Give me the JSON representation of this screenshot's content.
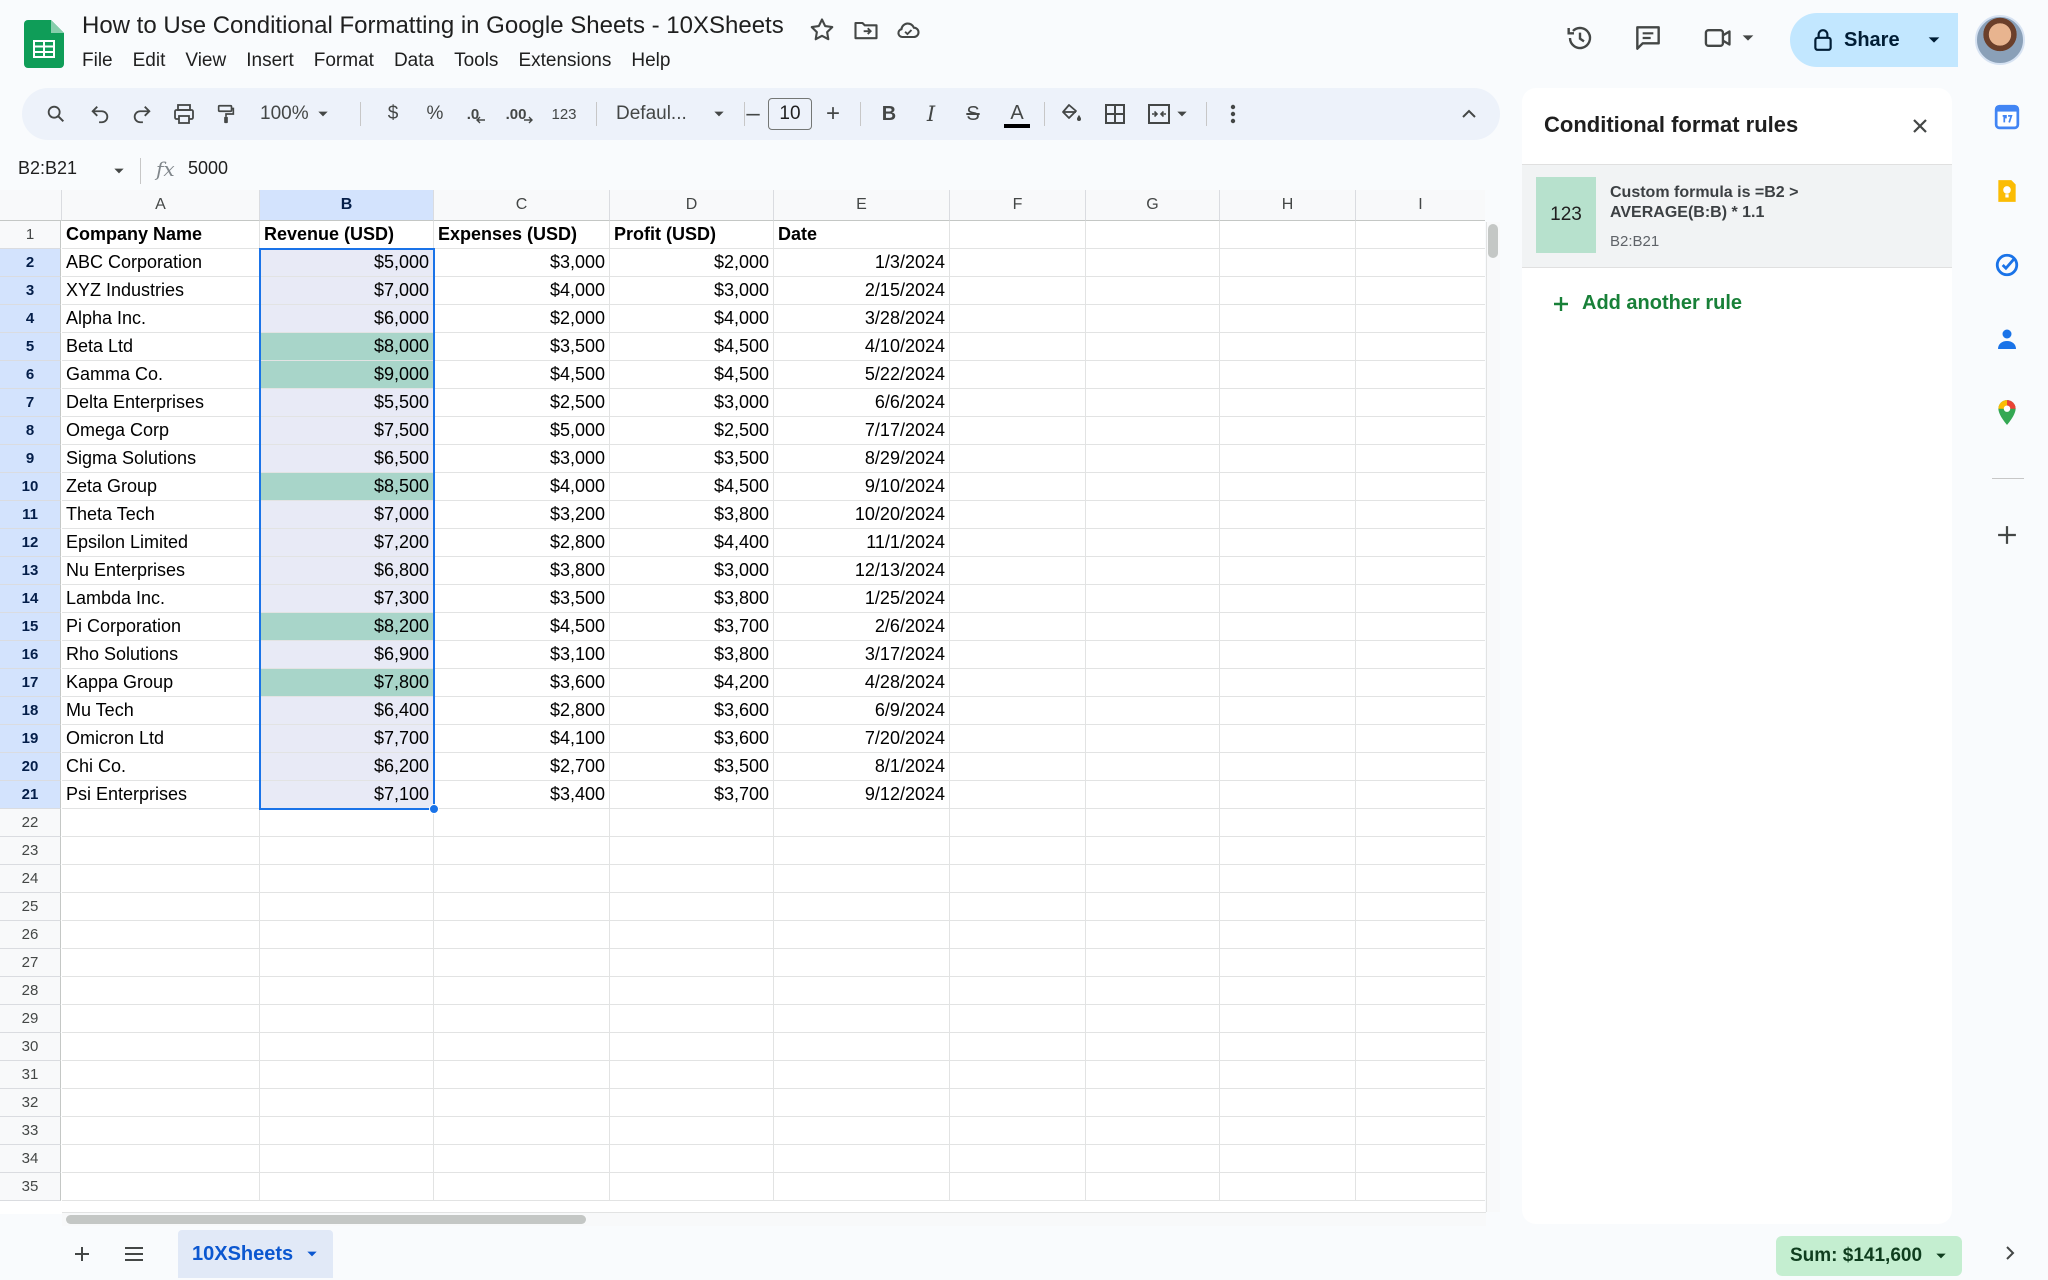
{
  "document": {
    "title": "How to Use Conditional Formatting in Google Sheets - 10XSheets"
  },
  "menu": [
    "File",
    "Edit",
    "View",
    "Insert",
    "Format",
    "Data",
    "Tools",
    "Extensions",
    "Help"
  ],
  "share": {
    "label": "Share"
  },
  "toolbar": {
    "zoom": "100%",
    "currency": "$",
    "percent": "%",
    "decrease_decimals": ".0",
    "increase_decimals": ".00",
    "number_format": "123",
    "font": "Defaul...",
    "font_size": "10",
    "minus": "–",
    "plus": "+",
    "bold": "B",
    "italic": "I",
    "strikethrough": "S",
    "text_color": "A"
  },
  "formula_bar": {
    "name_box": "B2:B21",
    "fx": "fx",
    "value": "5000"
  },
  "columns": [
    "A",
    "B",
    "C",
    "D",
    "E",
    "F",
    "G",
    "H",
    "I"
  ],
  "row_numbers": [
    "1",
    "2",
    "3",
    "4",
    "5",
    "6",
    "7",
    "8",
    "9",
    "10",
    "11",
    "12",
    "13",
    "14",
    "15",
    "16",
    "17",
    "18",
    "19",
    "20",
    "21",
    "22",
    "23",
    "24",
    "25",
    "26",
    "27",
    "28",
    "29",
    "30",
    "31",
    "32",
    "33",
    "34",
    "35"
  ],
  "table": {
    "headers": [
      "Company Name",
      "Revenue (USD)",
      "Expenses (USD)",
      "Profit (USD)",
      "Date"
    ],
    "rows": [
      [
        "ABC Corporation",
        "$5,000",
        "$3,000",
        "$2,000",
        "1/3/2024"
      ],
      [
        "XYZ Industries",
        "$7,000",
        "$4,000",
        "$3,000",
        "2/15/2024"
      ],
      [
        "Alpha Inc.",
        "$6,000",
        "$2,000",
        "$4,000",
        "3/28/2024"
      ],
      [
        "Beta Ltd",
        "$8,000",
        "$3,500",
        "$4,500",
        "4/10/2024"
      ],
      [
        "Gamma Co.",
        "$9,000",
        "$4,500",
        "$4,500",
        "5/22/2024"
      ],
      [
        "Delta Enterprises",
        "$5,500",
        "$2,500",
        "$3,000",
        "6/6/2024"
      ],
      [
        "Omega Corp",
        "$7,500",
        "$5,000",
        "$2,500",
        "7/17/2024"
      ],
      [
        "Sigma Solutions",
        "$6,500",
        "$3,000",
        "$3,500",
        "8/29/2024"
      ],
      [
        "Zeta Group",
        "$8,500",
        "$4,000",
        "$4,500",
        "9/10/2024"
      ],
      [
        "Theta Tech",
        "$7,000",
        "$3,200",
        "$3,800",
        "10/20/2024"
      ],
      [
        "Epsilon Limited",
        "$7,200",
        "$2,800",
        "$4,400",
        "11/1/2024"
      ],
      [
        "Nu Enterprises",
        "$6,800",
        "$3,800",
        "$3,000",
        "12/13/2024"
      ],
      [
        "Lambda Inc.",
        "$7,300",
        "$3,500",
        "$3,800",
        "1/25/2024"
      ],
      [
        "Pi Corporation",
        "$8,200",
        "$4,500",
        "$3,700",
        "2/6/2024"
      ],
      [
        "Rho Solutions",
        "$6,900",
        "$3,100",
        "$3,800",
        "3/17/2024"
      ],
      [
        "Kappa Group",
        "$7,800",
        "$3,600",
        "$4,200",
        "4/28/2024"
      ],
      [
        "Mu Tech",
        "$6,400",
        "$2,800",
        "$3,600",
        "6/9/2024"
      ],
      [
        "Omicron Ltd",
        "$7,700",
        "$4,100",
        "$3,600",
        "7/20/2024"
      ],
      [
        "Chi Co.",
        "$6,200",
        "$2,700",
        "$3,500",
        "8/1/2024"
      ],
      [
        "Psi Enterprises",
        "$7,100",
        "$3,400",
        "$3,700",
        "9/12/2024"
      ]
    ],
    "highlighted_rows": [
      3,
      4,
      8,
      13,
      15
    ],
    "highlight_color": "#a8d5c9",
    "selection_tint": "#e8eaf6"
  },
  "side_panel": {
    "title": "Conditional format rules",
    "rule": {
      "preview": "123",
      "description": "Custom formula is =B2 > AVERAGE(B:B) * 1.1",
      "range": "B2:B21",
      "color": "#b7e1cd"
    },
    "add_rule_label": "Add another rule"
  },
  "bottom": {
    "sheet_tab": "10XSheets",
    "sum": "Sum: $141,600"
  },
  "colors": {
    "accent": "#1a73e8",
    "share_bg": "#c2e7ff",
    "sum_bg": "#c4eed0",
    "add_rule_green": "#188038"
  }
}
